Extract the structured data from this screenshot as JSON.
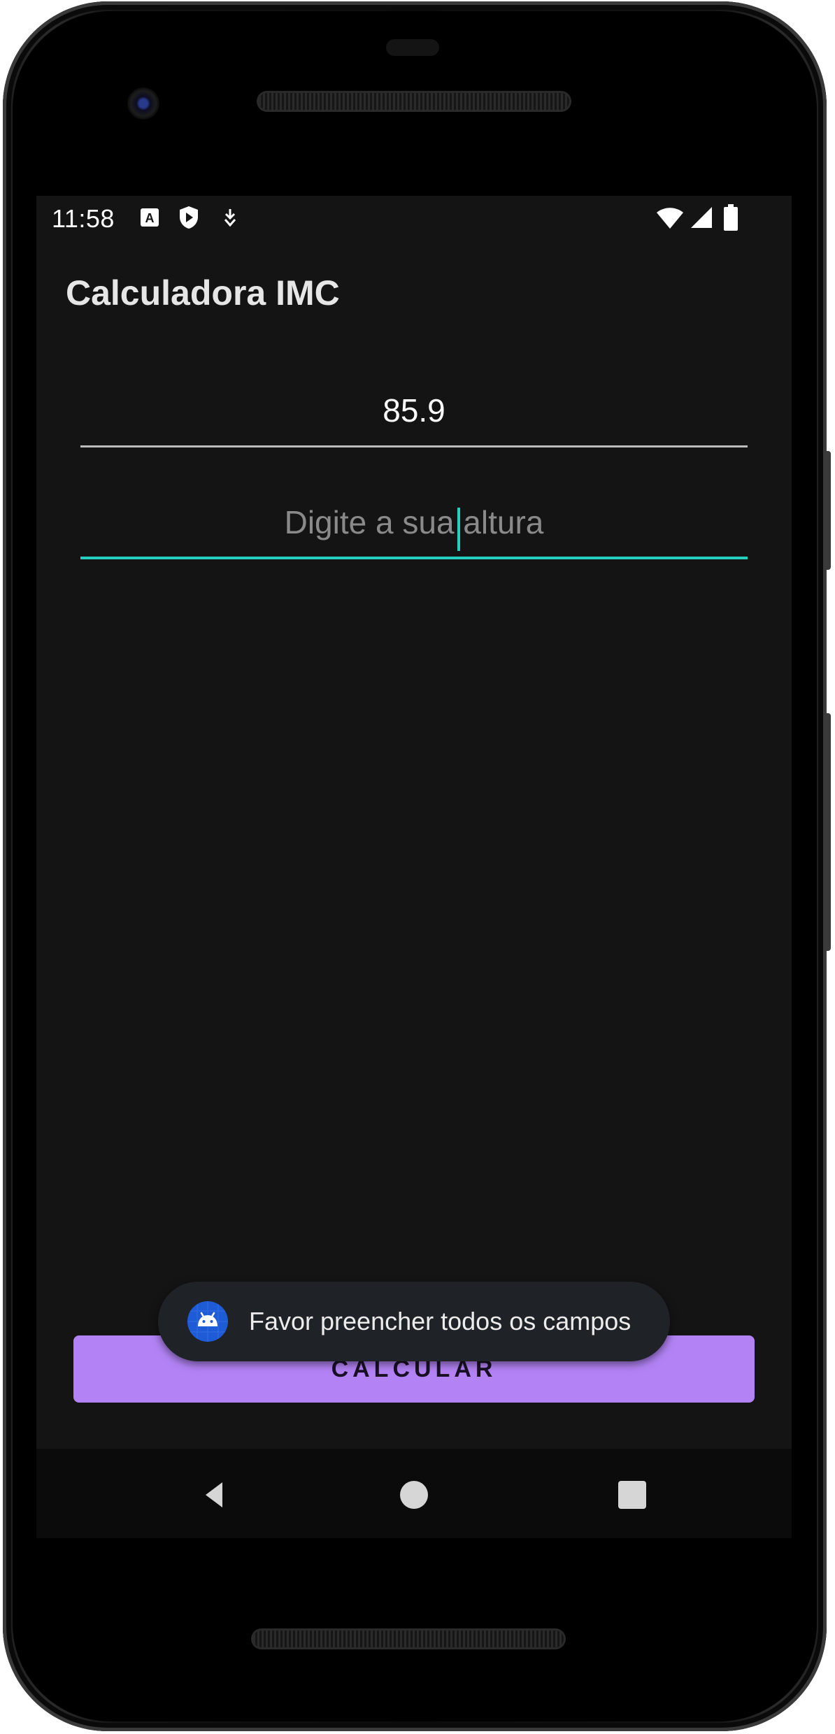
{
  "status_bar": {
    "time": "11:58",
    "left_icons": [
      "keyboard-a-icon",
      "shield-play-icon",
      "download-icon"
    ],
    "right_icons": [
      "wifi-icon",
      "signal-icon",
      "battery-icon"
    ]
  },
  "app_bar": {
    "title": "Calculadora IMC"
  },
  "form": {
    "weight_value": "85.9",
    "height_placeholder": "Digite a sua altura"
  },
  "calc_button": {
    "label": "CALCULAR"
  },
  "toast": {
    "message": "Favor preencher todos os campos",
    "icon": "android-icon"
  },
  "nav_bar": {
    "buttons": [
      "back-icon",
      "home-icon",
      "recents-icon"
    ]
  },
  "colors": {
    "background": "#141414",
    "accent": "#26d0c0",
    "button": "#b383f5",
    "toast": "#1f2226"
  }
}
